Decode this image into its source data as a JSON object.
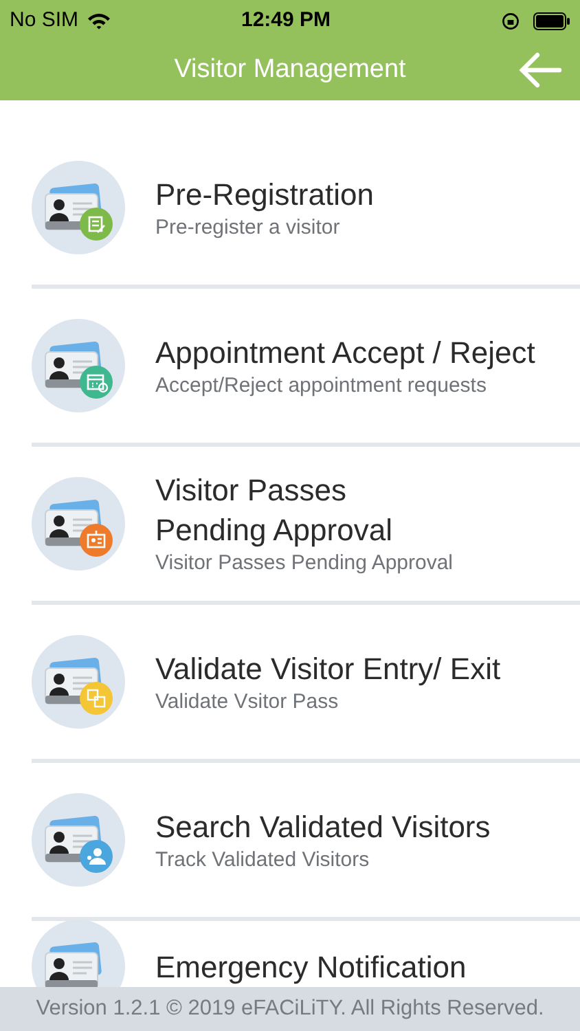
{
  "status_bar": {
    "carrier": "No SIM",
    "time": "12:49 PM"
  },
  "header": {
    "title": "Visitor Management"
  },
  "menu": [
    {
      "title": "Pre-Registration",
      "subtitle": "Pre-register a visitor",
      "kind": "form",
      "color": "#7dba4a"
    },
    {
      "title": "Appointment Accept / Reject",
      "subtitle": "Accept/Reject appointment requests",
      "kind": "calendar",
      "color": "#3fb88f"
    },
    {
      "title": "Visitor Passes\nPending Approval",
      "subtitle": "Visitor Passes Pending Approval",
      "kind": "pass",
      "color": "#ee7b2c"
    },
    {
      "title": "Validate Visitor Entry/ Exit",
      "subtitle": "Validate Vsitor Pass",
      "kind": "exchange",
      "color": "#f4c534"
    },
    {
      "title": "Search Validated Visitors",
      "subtitle": "Track Validated Visitors",
      "kind": "people",
      "color": "#4aa6dc"
    },
    {
      "title": "Emergency Notification",
      "kind": "plain"
    }
  ],
  "footer": {
    "text": "Version 1.2.1 © 2019 eFACiLiTY. All Rights Reserved."
  }
}
